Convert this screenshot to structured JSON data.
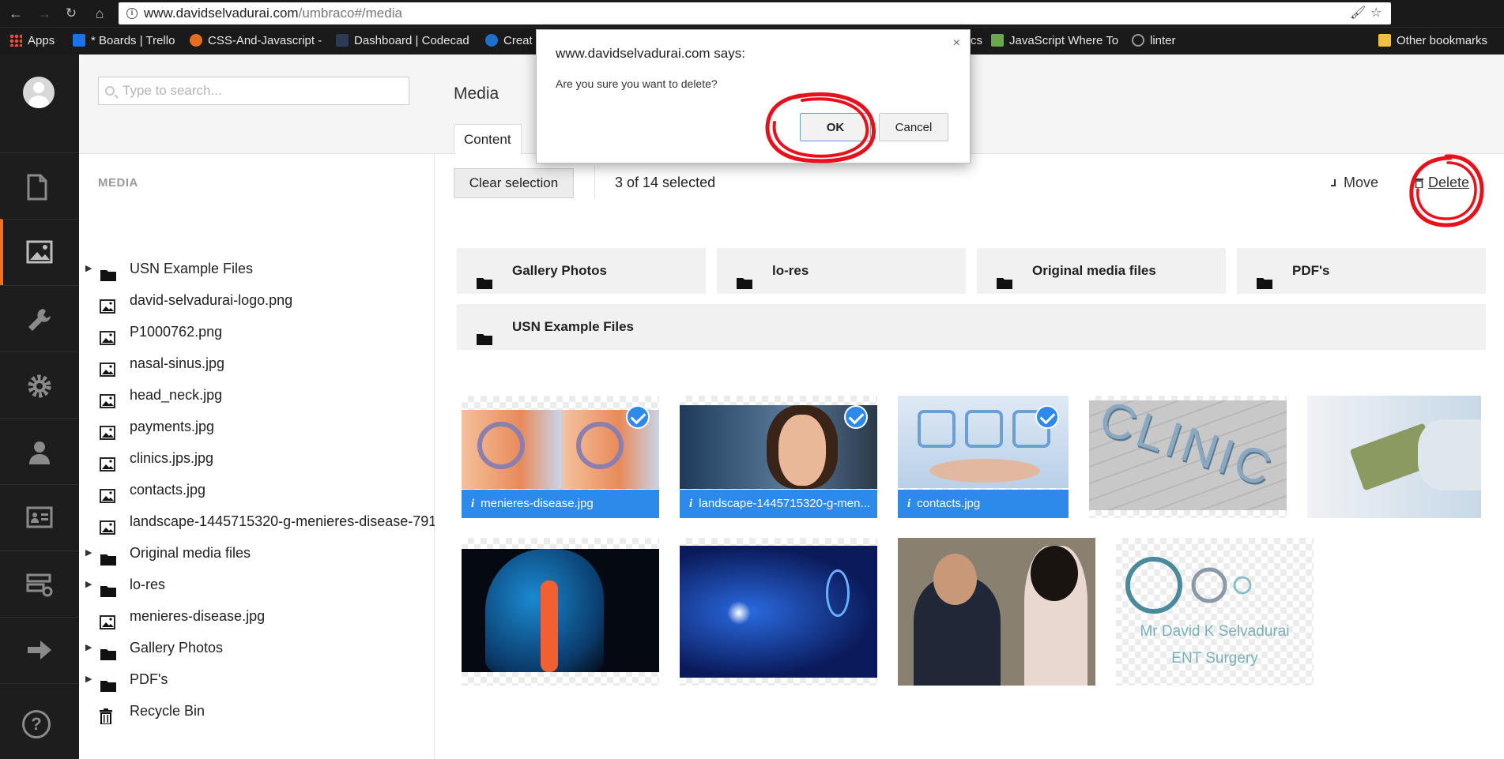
{
  "browser": {
    "url_host": "www.davidselvadurai.com",
    "url_path": "/umbraco#/media",
    "bookmarks": [
      {
        "label": "Apps"
      },
      {
        "label": "* Boards | Trello"
      },
      {
        "label": "CSS-And-Javascript -"
      },
      {
        "label": "Dashboard | Codecad"
      },
      {
        "label": "Creat"
      },
      {
        "label": "cs"
      },
      {
        "label": "JavaScript Where To"
      },
      {
        "label": "linter"
      },
      {
        "label": "Other bookmarks"
      }
    ]
  },
  "search": {
    "placeholder": "Type to search..."
  },
  "tree": {
    "heading": "MEDIA",
    "items": [
      {
        "label": "USN Example Files",
        "type": "folder",
        "expandable": true
      },
      {
        "label": "david-selvadurai-logo.png",
        "type": "image"
      },
      {
        "label": "P1000762.png",
        "type": "image"
      },
      {
        "label": "nasal-sinus.jpg",
        "type": "image"
      },
      {
        "label": "head_neck.jpg",
        "type": "image"
      },
      {
        "label": "payments.jpg",
        "type": "image"
      },
      {
        "label": "clinics.jps.jpg",
        "type": "image"
      },
      {
        "label": "contacts.jpg",
        "type": "image"
      },
      {
        "label": "landscape-1445715320-g-menieres-disease-791",
        "type": "image"
      },
      {
        "label": "Original media files",
        "type": "folder",
        "expandable": true
      },
      {
        "label": "lo-res",
        "type": "folder",
        "expandable": true
      },
      {
        "label": "menieres-disease.jpg",
        "type": "image"
      },
      {
        "label": "Gallery Photos",
        "type": "folder",
        "expandable": true
      },
      {
        "label": "PDF's",
        "type": "folder",
        "expandable": true
      },
      {
        "label": "Recycle Bin",
        "type": "trash"
      }
    ]
  },
  "main": {
    "title": "Media",
    "tab": "Content",
    "clear_selection": "Clear selection",
    "selection_count": "3 of 14 selected",
    "move_label": "Move",
    "delete_label": "Delete",
    "folders": [
      "Gallery Photos",
      "lo-res",
      "Original media files",
      "PDF's",
      "USN Example Files"
    ],
    "media": [
      {
        "caption": "menieres-disease.jpg",
        "selected": true
      },
      {
        "caption": "landscape-1445715320-g-men...",
        "selected": true
      },
      {
        "caption": "contacts.jpg",
        "selected": true
      },
      {
        "caption": "",
        "selected": false
      },
      {
        "caption": "",
        "selected": false
      },
      {
        "caption": "",
        "selected": false
      },
      {
        "caption": "",
        "selected": false
      },
      {
        "caption": "",
        "selected": false
      },
      {
        "caption": "",
        "selected": false
      }
    ],
    "logo_text_line1": "Mr David K Selvadurai",
    "logo_text_line2": "ENT Surgery"
  },
  "dialog": {
    "title": "www.davidselvadurai.com says:",
    "message": "Are you sure you want to delete?",
    "ok": "OK",
    "cancel": "Cancel",
    "close": "×"
  },
  "colors": {
    "accent": "#f36f21",
    "selected_blue": "#2e8aea",
    "annotation_red": "#e8101a"
  }
}
